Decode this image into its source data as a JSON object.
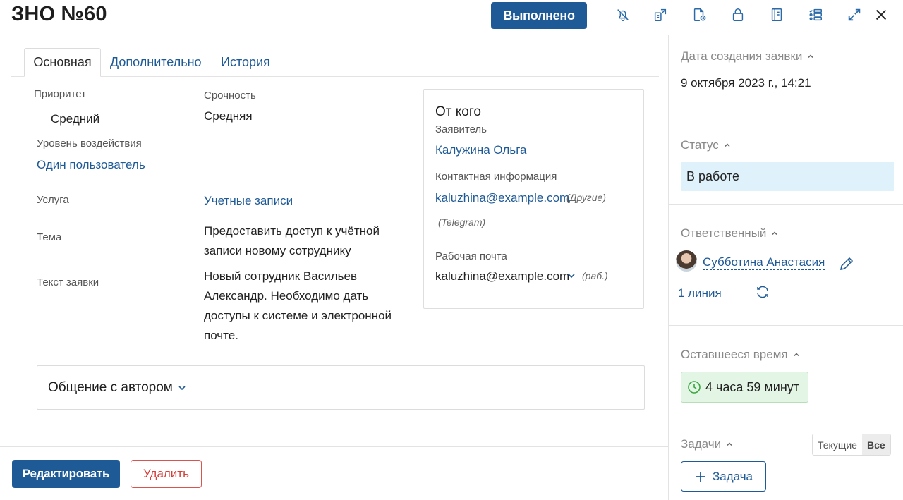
{
  "header": {
    "title": "ЗНО №60",
    "done_label": "Выполнено",
    "icons": [
      "bell-off-icon",
      "transfer-icon",
      "file-move-icon",
      "lock-icon",
      "notebook-icon",
      "checklist-icon",
      "expand-icon",
      "close-icon"
    ]
  },
  "tabs": [
    {
      "label": "Основная",
      "active": true
    },
    {
      "label": "Дополнительно",
      "active": false
    },
    {
      "label": "История",
      "active": false
    }
  ],
  "fields": {
    "priority_label": "Приоритет",
    "priority_value": "Средний",
    "urgency_label": "Срочность",
    "urgency_value": "Средняя",
    "impact_label": "Уровень воздействия",
    "impact_value": "Один пользователь",
    "service_label": "Услуга",
    "service_value": "Учетные записи",
    "subject_label": "Тема",
    "subject_value": "Предоставить доступ к учётной записи новому сотруднику",
    "text_label": "Текст заявки",
    "text_value": "Новый сотрудник Васильев Александр. Необходимо дать доступы к системе и электронной почте."
  },
  "contact_card": {
    "title": "От кого",
    "applicant_label": "Заявитель",
    "applicant_value": "Калужина Ольга",
    "contact_label": "Контактная информация",
    "contact_email": "kaluzhina@example.com",
    "contact_note_1": "(Другие)",
    "contact_note_2": "(Telegram)",
    "work_email_label": "Рабочая почта",
    "work_email": "kaluzhina@example.com",
    "work_note": "(раб.)"
  },
  "communication": {
    "title": "Общение с автором"
  },
  "footer": {
    "edit_label": "Редактировать",
    "delete_label": "Удалить"
  },
  "right_panel": {
    "created_label": "Дата создания заявки",
    "created_value": "9 октября 2023 г., 14:21",
    "status_label": "Статус",
    "status_value": "В работе",
    "responsible_label": "Ответственный",
    "responsible_name": "Субботина Анастасия",
    "line_value": "1 линия",
    "remaining_label": "Оставшееся время",
    "remaining_value": "4 часа 59 минут",
    "tasks_label": "Задачи",
    "tasks_filter_current": "Текущие",
    "tasks_filter_all": "Все",
    "add_task_label": "Задача"
  },
  "colors": {
    "primary": "#1e5a96",
    "status_bg": "#dff1fa",
    "timer_bg": "#e3f5e4",
    "danger": "#d43f3a"
  }
}
